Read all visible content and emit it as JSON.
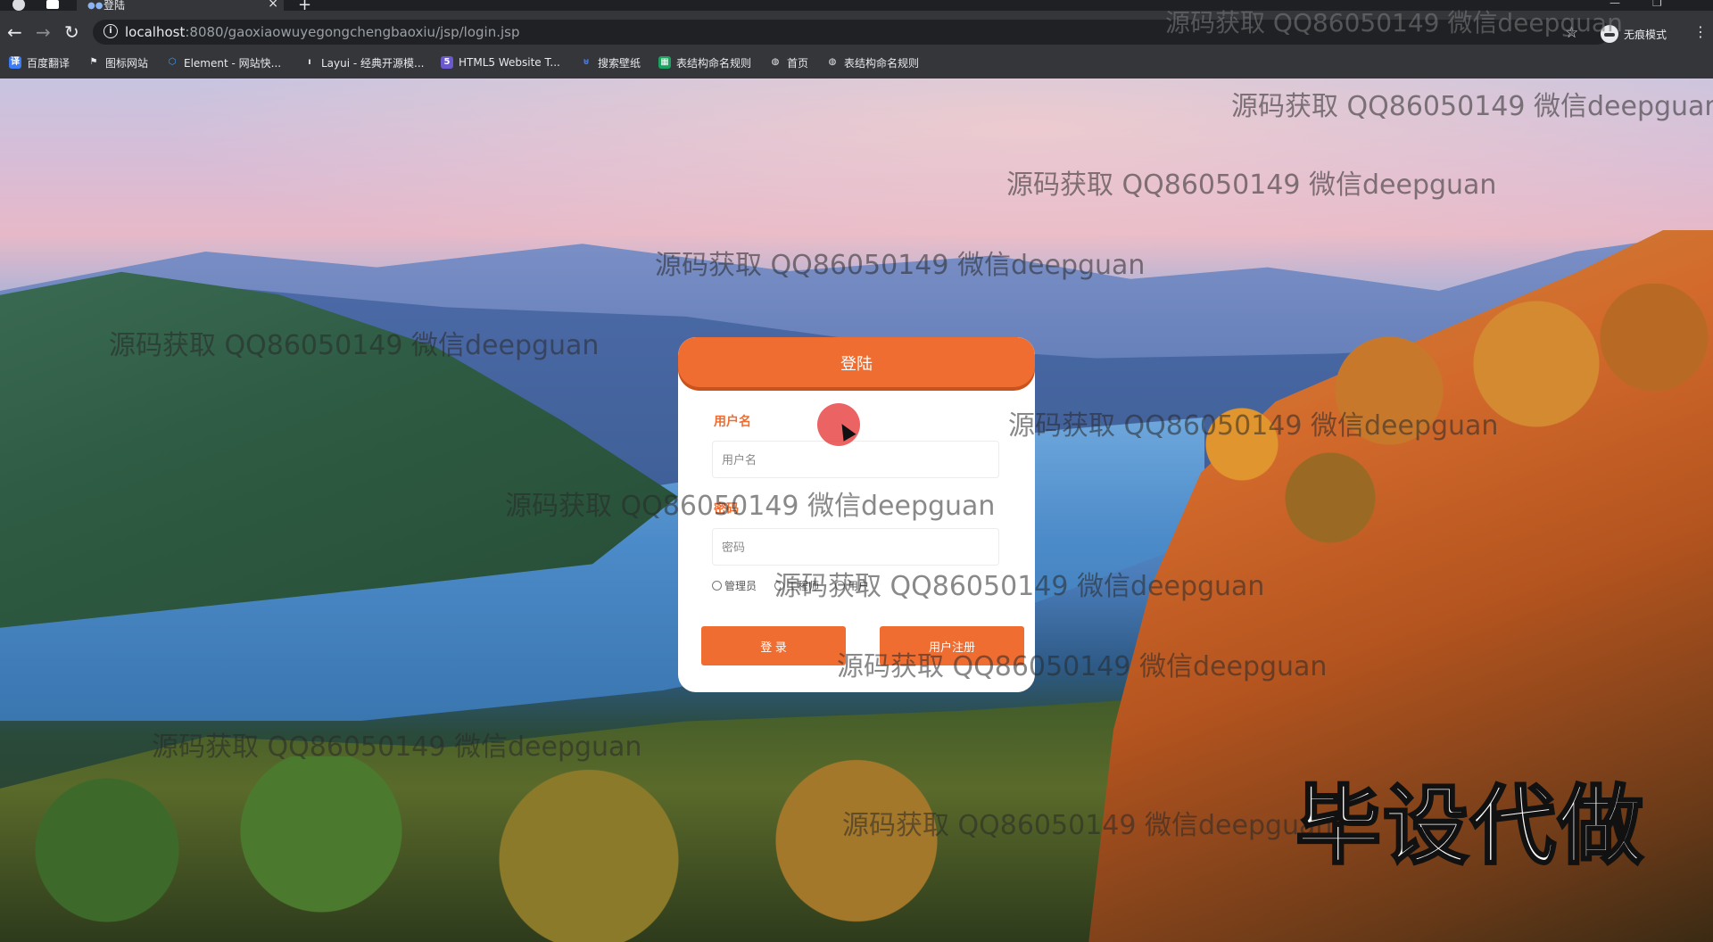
{
  "browser": {
    "tab_title": "登陆",
    "tab_close": "×",
    "new_tab": "+",
    "url_host": "localhost",
    "url_path": ":8080/gaoxiaowuyegongchengbaoxiu/jsp/login.jsp",
    "incognito_label": "无痕模式",
    "bookmarks": [
      {
        "label": "百度翻译",
        "icon": "translate-icon",
        "color": "#3b7bf6"
      },
      {
        "label": "图标网站",
        "icon": "flag-icon",
        "color": "#ffffff"
      },
      {
        "label": "Element - 网站快...",
        "icon": "element-icon",
        "color": "#409eff"
      },
      {
        "label": "Layui - 经典开源模...",
        "icon": "layui-icon",
        "color": "#e8eaed"
      },
      {
        "label": "HTML5 Website T...",
        "icon": "html5-icon",
        "color": "#6a5acd"
      },
      {
        "label": "搜索壁纸",
        "icon": "wallpaper-icon",
        "color": "#4a7be0"
      },
      {
        "label": "表结构命名规则",
        "icon": "sheet-icon",
        "color": "#1aa260"
      },
      {
        "label": "首页",
        "icon": "globe-icon",
        "color": "#e8eaed"
      },
      {
        "label": "表结构命名规则",
        "icon": "globe-icon",
        "color": "#e8eaed"
      }
    ]
  },
  "login": {
    "title": "登陆",
    "username_label": "用户名",
    "username_placeholder": "用户名",
    "password_label": "密码",
    "password_placeholder": "密码",
    "roles": [
      "管理员",
      "工程师",
      "用户"
    ],
    "login_button": "登 录",
    "register_button": "用户注册"
  },
  "watermark_text": "源码获取 QQ86050149 微信deepguan",
  "stamp_text": "毕设代做",
  "colors": {
    "accent": "#ef6d31",
    "chrome": "#35363a"
  }
}
